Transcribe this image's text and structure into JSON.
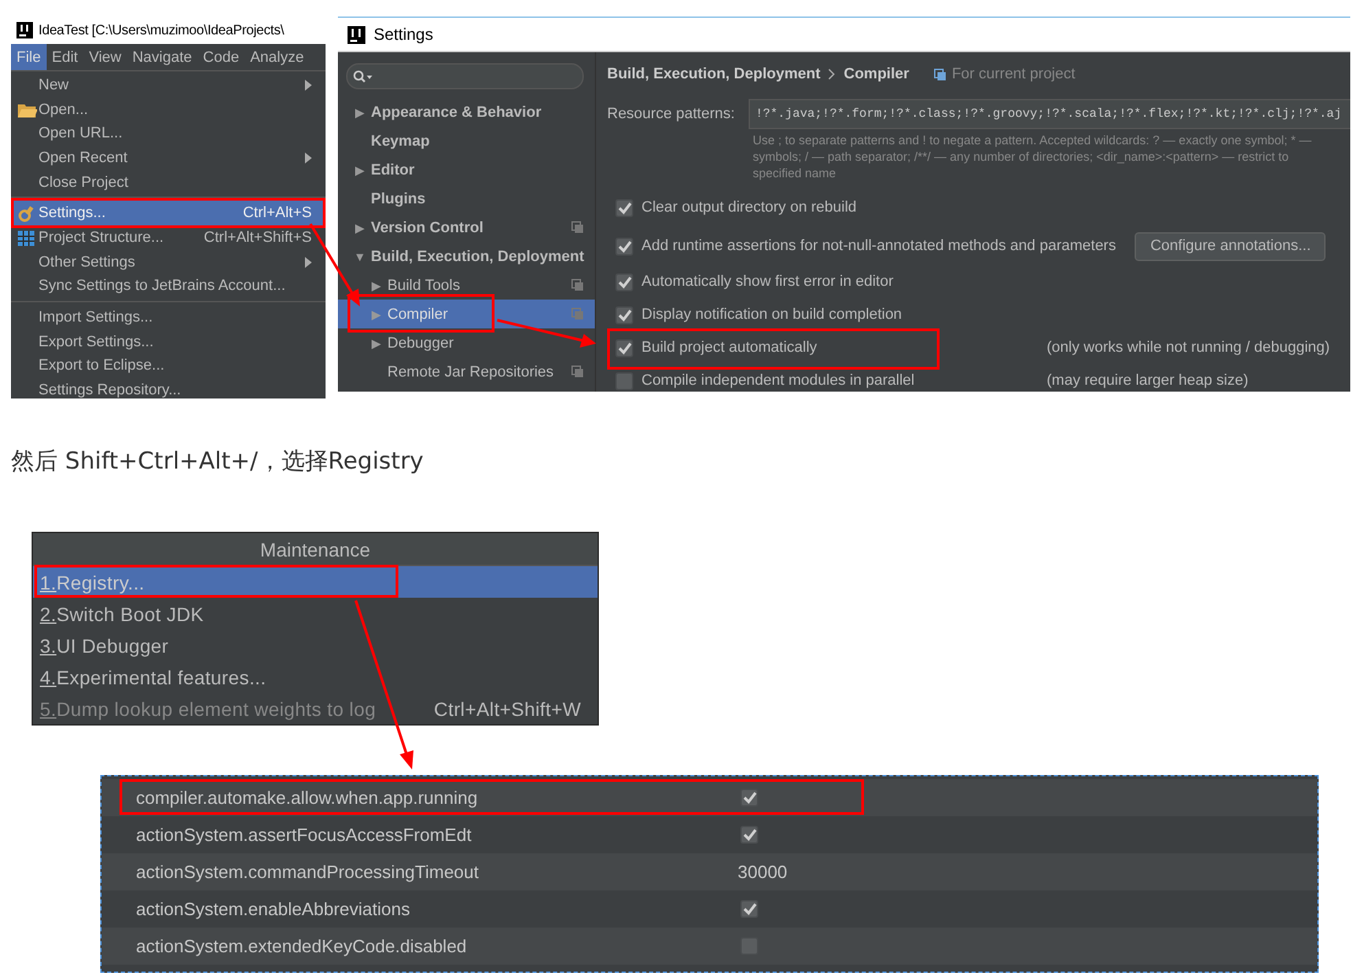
{
  "ide_menu": {
    "title": "IdeaTest [C:\\Users\\muzimoo\\IdeaProjects\\",
    "menubar": [
      {
        "label": "File",
        "selected": true
      },
      {
        "label": "Edit",
        "selected": false
      },
      {
        "label": "View",
        "selected": false
      },
      {
        "label": "Navigate",
        "selected": false
      },
      {
        "label": "Code",
        "selected": false
      },
      {
        "label": "Analyze",
        "selected": false
      }
    ],
    "groups": [
      [
        {
          "label": "New",
          "submenu": true,
          "selected": false,
          "highlighted": false
        },
        {
          "label": "Open...",
          "submenu": false,
          "selected": false,
          "highlighted": false
        },
        {
          "label": "Open URL...",
          "submenu": false,
          "selected": false,
          "highlighted": false
        },
        {
          "label": "Open Recent",
          "submenu": true,
          "selected": false,
          "highlighted": false
        },
        {
          "label": "Close Project",
          "submenu": false,
          "selected": false,
          "highlighted": false
        }
      ],
      [
        {
          "label": "Settings...",
          "shortcut": "Ctrl+Alt+S",
          "submenu": false,
          "selected": true,
          "highlighted": true
        },
        {
          "label": "Project Structure...",
          "shortcut": "Ctrl+Alt+Shift+S",
          "submenu": false,
          "selected": false,
          "highlighted": false
        },
        {
          "label": "Other Settings",
          "submenu": true,
          "selected": false,
          "highlighted": false
        },
        {
          "label": "Sync Settings to JetBrains Account...",
          "submenu": false,
          "selected": false,
          "highlighted": false
        }
      ],
      [
        {
          "label": "Import Settings...",
          "submenu": false,
          "selected": false,
          "highlighted": false
        },
        {
          "label": "Export Settings...",
          "submenu": false,
          "selected": false,
          "highlighted": false
        },
        {
          "label": "Export to Eclipse...",
          "submenu": false,
          "selected": false,
          "highlighted": false
        },
        {
          "label": "Settings Repository...",
          "submenu": false,
          "selected": false,
          "highlighted": false
        }
      ]
    ]
  },
  "settings": {
    "title": "Settings",
    "tree": [
      {
        "label": "Appearance & Behavior",
        "toggle": "▶",
        "selected": false,
        "project_level": false,
        "highlighted": false
      },
      {
        "label": "Keymap",
        "selected": false,
        "project_level": false,
        "highlighted": false
      },
      {
        "label": "Editor",
        "toggle": "▶",
        "selected": false,
        "project_level": false,
        "highlighted": false
      },
      {
        "label": "Plugins",
        "selected": false,
        "project_level": false,
        "highlighted": false
      },
      {
        "label": "Version Control",
        "toggle": "▶",
        "selected": false,
        "project_level": true,
        "highlighted": false
      },
      {
        "label": "Build, Execution, Deployment",
        "toggle": "▼",
        "selected": false,
        "project_level": false,
        "highlighted": false,
        "children": [
          {
            "label": "Build Tools",
            "toggle": "▶",
            "selected": false,
            "project_level": true,
            "highlighted": false
          },
          {
            "label": "Compiler",
            "toggle": "▶",
            "selected": true,
            "project_level": true,
            "highlighted": true
          },
          {
            "label": "Debugger",
            "toggle": "▶",
            "selected": false,
            "project_level": false,
            "highlighted": false
          },
          {
            "label": "Remote Jar Repositories",
            "selected": false,
            "project_level": true,
            "highlighted": false
          }
        ]
      }
    ],
    "breadcrumb": [
      "Build, Execution, Deployment",
      "Compiler"
    ],
    "scope": "For current project",
    "resource_patterns": {
      "label": "Resource patterns:",
      "value": "!?*.java;!?*.form;!?*.class;!?*.groovy;!?*.scala;!?*.flex;!?*.kt;!?*.clj;!?*.aj"
    },
    "hint_lines": [
      "Use ; to separate patterns and ! to negate a pattern. Accepted wildcards: ? — exactly one symbol; * —",
      "symbols; / — path separator; /**/ — any number of directories; <dir_name>:<pattern> — restrict to",
      "specified name"
    ],
    "options": [
      {
        "label": "Clear output directory on rebuild",
        "checked": true,
        "highlighted": false
      },
      {
        "label": "Add runtime assertions for not-null-annotated methods and parameters",
        "checked": true,
        "highlighted": false,
        "button": "Configure annotations..."
      },
      {
        "label": "Automatically show first error in editor",
        "checked": true,
        "highlighted": false
      },
      {
        "label": "Display notification on build completion",
        "checked": true,
        "highlighted": false
      },
      {
        "label": "Build project automatically",
        "checked": true,
        "highlighted": true,
        "note": "(only works while not running / debugging)"
      },
      {
        "label": "Compile independent modules in parallel",
        "checked": false,
        "highlighted": false,
        "note": "(may require larger heap size)"
      }
    ]
  },
  "paragraph": "然后 Shift+Ctrl+Alt+/，选择Registry",
  "maintenance": {
    "title": "Maintenance",
    "items": [
      {
        "number": "1.",
        "label": "Registry...",
        "selected": true,
        "highlighted": true,
        "disabled": false
      },
      {
        "number": "2.",
        "label": "Switch Boot JDK",
        "selected": false,
        "highlighted": false,
        "disabled": false
      },
      {
        "number": "3.",
        "label": "UI Debugger",
        "selected": false,
        "highlighted": false,
        "disabled": false
      },
      {
        "number": "4.",
        "label": "Experimental features...",
        "selected": false,
        "highlighted": false,
        "disabled": false
      },
      {
        "number": "5.",
        "label": "Dump lookup element weights to log",
        "shortcut": "Ctrl+Alt+Shift+W",
        "selected": false,
        "highlighted": false,
        "disabled": true
      }
    ]
  },
  "registry": {
    "rows": [
      {
        "key": "compiler.automake.allow.when.app.running",
        "kind": "checkbox",
        "checked": true,
        "highlighted": true
      },
      {
        "key": "actionSystem.assertFocusAccessFromEdt",
        "kind": "checkbox",
        "checked": true,
        "highlighted": false
      },
      {
        "key": "actionSystem.commandProcessingTimeout",
        "kind": "text",
        "value": "30000",
        "highlighted": false
      },
      {
        "key": "actionSystem.enableAbbreviations",
        "kind": "checkbox",
        "checked": true,
        "highlighted": false
      },
      {
        "key": "actionSystem.extendedKeyCode.disabled",
        "kind": "checkbox",
        "checked": false,
        "highlighted": false
      }
    ]
  }
}
